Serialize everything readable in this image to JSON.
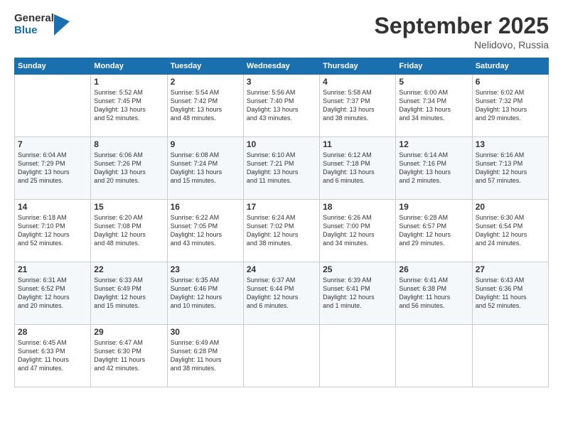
{
  "header": {
    "logo_general": "General",
    "logo_blue": "Blue",
    "month": "September 2025",
    "location": "Nelidovo, Russia"
  },
  "weekdays": [
    "Sunday",
    "Monday",
    "Tuesday",
    "Wednesday",
    "Thursday",
    "Friday",
    "Saturday"
  ],
  "weeks": [
    [
      {
        "day": "",
        "info": ""
      },
      {
        "day": "1",
        "info": "Sunrise: 5:52 AM\nSunset: 7:45 PM\nDaylight: 13 hours\nand 52 minutes."
      },
      {
        "day": "2",
        "info": "Sunrise: 5:54 AM\nSunset: 7:42 PM\nDaylight: 13 hours\nand 48 minutes."
      },
      {
        "day": "3",
        "info": "Sunrise: 5:56 AM\nSunset: 7:40 PM\nDaylight: 13 hours\nand 43 minutes."
      },
      {
        "day": "4",
        "info": "Sunrise: 5:58 AM\nSunset: 7:37 PM\nDaylight: 13 hours\nand 38 minutes."
      },
      {
        "day": "5",
        "info": "Sunrise: 6:00 AM\nSunset: 7:34 PM\nDaylight: 13 hours\nand 34 minutes."
      },
      {
        "day": "6",
        "info": "Sunrise: 6:02 AM\nSunset: 7:32 PM\nDaylight: 13 hours\nand 29 minutes."
      }
    ],
    [
      {
        "day": "7",
        "info": "Sunrise: 6:04 AM\nSunset: 7:29 PM\nDaylight: 13 hours\nand 25 minutes."
      },
      {
        "day": "8",
        "info": "Sunrise: 6:06 AM\nSunset: 7:26 PM\nDaylight: 13 hours\nand 20 minutes."
      },
      {
        "day": "9",
        "info": "Sunrise: 6:08 AM\nSunset: 7:24 PM\nDaylight: 13 hours\nand 15 minutes."
      },
      {
        "day": "10",
        "info": "Sunrise: 6:10 AM\nSunset: 7:21 PM\nDaylight: 13 hours\nand 11 minutes."
      },
      {
        "day": "11",
        "info": "Sunrise: 6:12 AM\nSunset: 7:18 PM\nDaylight: 13 hours\nand 6 minutes."
      },
      {
        "day": "12",
        "info": "Sunrise: 6:14 AM\nSunset: 7:16 PM\nDaylight: 13 hours\nand 2 minutes."
      },
      {
        "day": "13",
        "info": "Sunrise: 6:16 AM\nSunset: 7:13 PM\nDaylight: 12 hours\nand 57 minutes."
      }
    ],
    [
      {
        "day": "14",
        "info": "Sunrise: 6:18 AM\nSunset: 7:10 PM\nDaylight: 12 hours\nand 52 minutes."
      },
      {
        "day": "15",
        "info": "Sunrise: 6:20 AM\nSunset: 7:08 PM\nDaylight: 12 hours\nand 48 minutes."
      },
      {
        "day": "16",
        "info": "Sunrise: 6:22 AM\nSunset: 7:05 PM\nDaylight: 12 hours\nand 43 minutes."
      },
      {
        "day": "17",
        "info": "Sunrise: 6:24 AM\nSunset: 7:02 PM\nDaylight: 12 hours\nand 38 minutes."
      },
      {
        "day": "18",
        "info": "Sunrise: 6:26 AM\nSunset: 7:00 PM\nDaylight: 12 hours\nand 34 minutes."
      },
      {
        "day": "19",
        "info": "Sunrise: 6:28 AM\nSunset: 6:57 PM\nDaylight: 12 hours\nand 29 minutes."
      },
      {
        "day": "20",
        "info": "Sunrise: 6:30 AM\nSunset: 6:54 PM\nDaylight: 12 hours\nand 24 minutes."
      }
    ],
    [
      {
        "day": "21",
        "info": "Sunrise: 6:31 AM\nSunset: 6:52 PM\nDaylight: 12 hours\nand 20 minutes."
      },
      {
        "day": "22",
        "info": "Sunrise: 6:33 AM\nSunset: 6:49 PM\nDaylight: 12 hours\nand 15 minutes."
      },
      {
        "day": "23",
        "info": "Sunrise: 6:35 AM\nSunset: 6:46 PM\nDaylight: 12 hours\nand 10 minutes."
      },
      {
        "day": "24",
        "info": "Sunrise: 6:37 AM\nSunset: 6:44 PM\nDaylight: 12 hours\nand 6 minutes."
      },
      {
        "day": "25",
        "info": "Sunrise: 6:39 AM\nSunset: 6:41 PM\nDaylight: 12 hours\nand 1 minute."
      },
      {
        "day": "26",
        "info": "Sunrise: 6:41 AM\nSunset: 6:38 PM\nDaylight: 11 hours\nand 56 minutes."
      },
      {
        "day": "27",
        "info": "Sunrise: 6:43 AM\nSunset: 6:36 PM\nDaylight: 11 hours\nand 52 minutes."
      }
    ],
    [
      {
        "day": "28",
        "info": "Sunrise: 6:45 AM\nSunset: 6:33 PM\nDaylight: 11 hours\nand 47 minutes."
      },
      {
        "day": "29",
        "info": "Sunrise: 6:47 AM\nSunset: 6:30 PM\nDaylight: 11 hours\nand 42 minutes."
      },
      {
        "day": "30",
        "info": "Sunrise: 6:49 AM\nSunset: 6:28 PM\nDaylight: 11 hours\nand 38 minutes."
      },
      {
        "day": "",
        "info": ""
      },
      {
        "day": "",
        "info": ""
      },
      {
        "day": "",
        "info": ""
      },
      {
        "day": "",
        "info": ""
      }
    ]
  ]
}
